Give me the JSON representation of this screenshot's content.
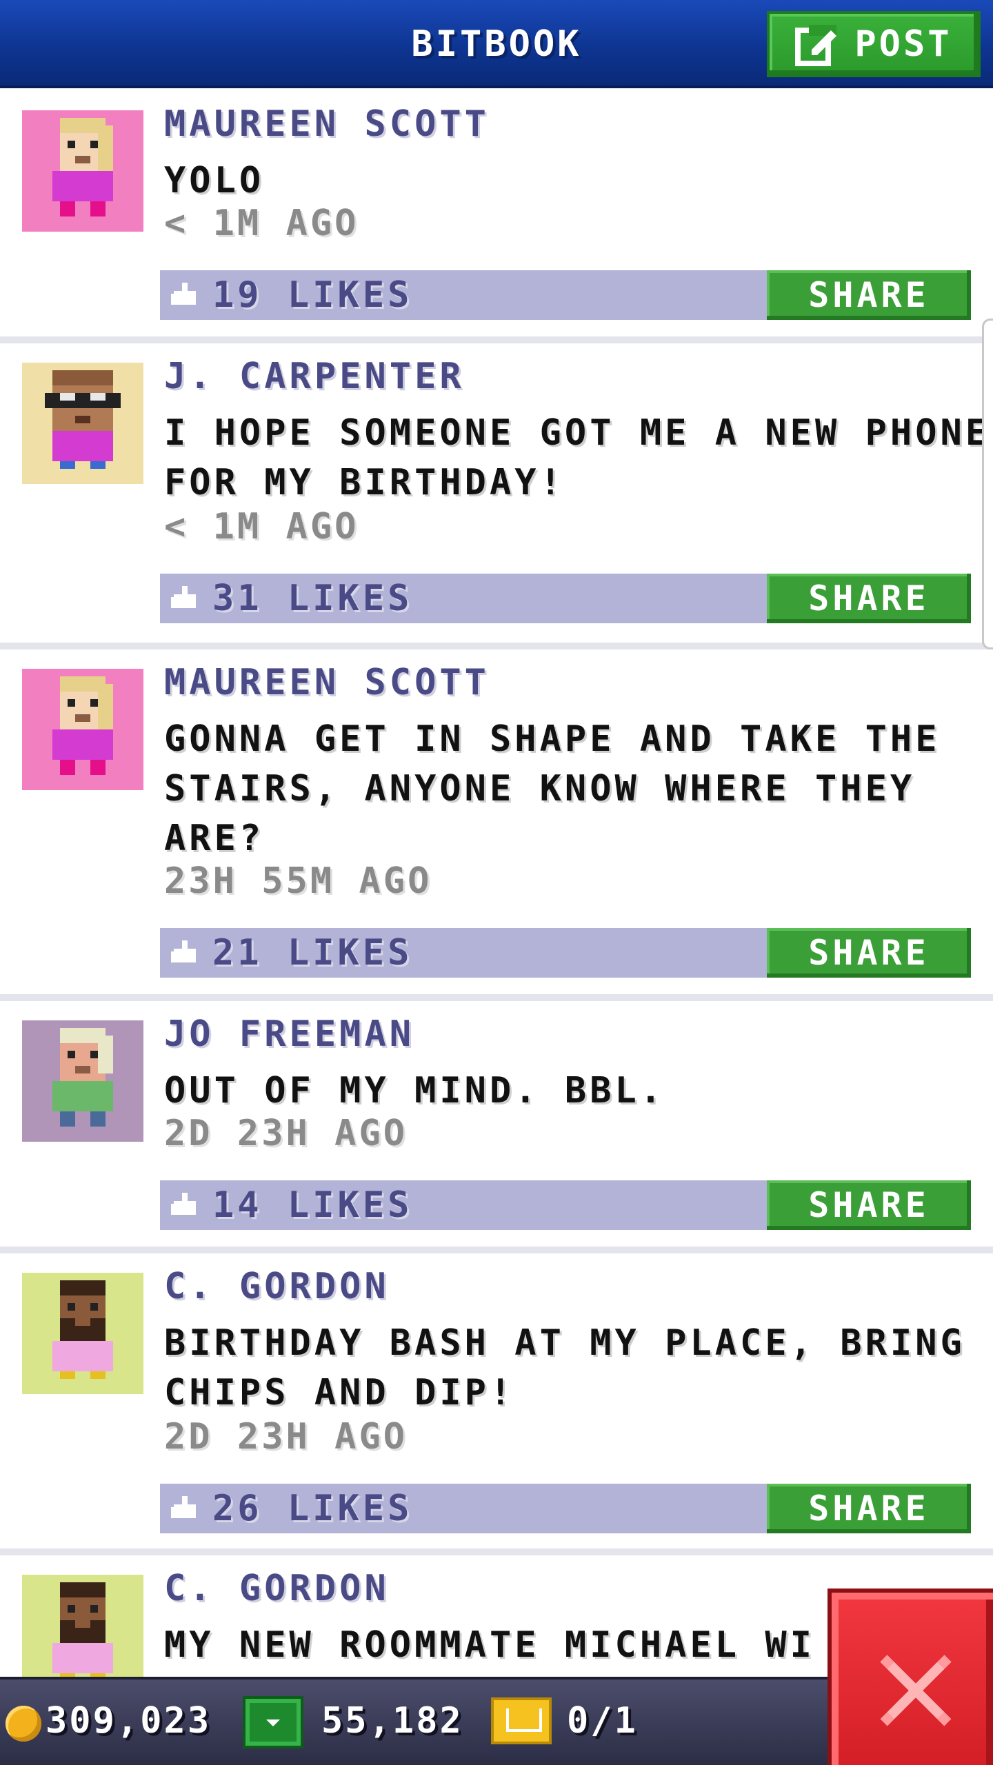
{
  "header": {
    "title": "BITBOOK",
    "post_label": "POST"
  },
  "posts": [
    {
      "author": "MAUREEN SCOTT",
      "message": "YOLO",
      "time": "< 1M AGO",
      "likes": "19 LIKES",
      "share_label": "SHARE",
      "avatar_bg": "#f27fc0"
    },
    {
      "author": "J. CARPENTER",
      "message": "I HOPE SOMEONE GOT ME A NEW PHONE\nFOR MY BIRTHDAY!",
      "time": "< 1M AGO",
      "likes": "31 LIKES",
      "share_label": "SHARE",
      "avatar_bg": "#f0e0a8"
    },
    {
      "author": "MAUREEN SCOTT",
      "message": "GONNA GET IN SHAPE AND TAKE THE\nSTAIRS, ANYONE KNOW WHERE THEY\nARE?",
      "time": "23H 55M AGO",
      "likes": "21 LIKES",
      "share_label": "SHARE",
      "avatar_bg": "#f27fc0"
    },
    {
      "author": "JO FREEMAN",
      "message": "OUT OF MY MIND. BBL.",
      "time": "2D 23H AGO",
      "likes": "14 LIKES",
      "share_label": "SHARE",
      "avatar_bg": "#b095b8"
    },
    {
      "author": "C. GORDON",
      "message": "BIRTHDAY BASH AT MY PLACE, BRING\nCHIPS AND DIP!",
      "time": "2D 23H AGO",
      "likes": "26 LIKES",
      "share_label": "SHARE",
      "avatar_bg": "#d9e58a"
    },
    {
      "author": "C. GORDON",
      "message": "MY NEW ROOMMATE MICHAEL WI",
      "time": "",
      "likes": "",
      "share_label": "",
      "avatar_bg": "#d9e58a"
    }
  ],
  "status": {
    "coins": "309,023",
    "bux": "55,182",
    "tickets": "0/1"
  },
  "colors": {
    "header_blue": "#0e3592",
    "like_bar": "#b2b3d6",
    "share_green": "#3a9f37",
    "close_red": "#e02a31"
  }
}
